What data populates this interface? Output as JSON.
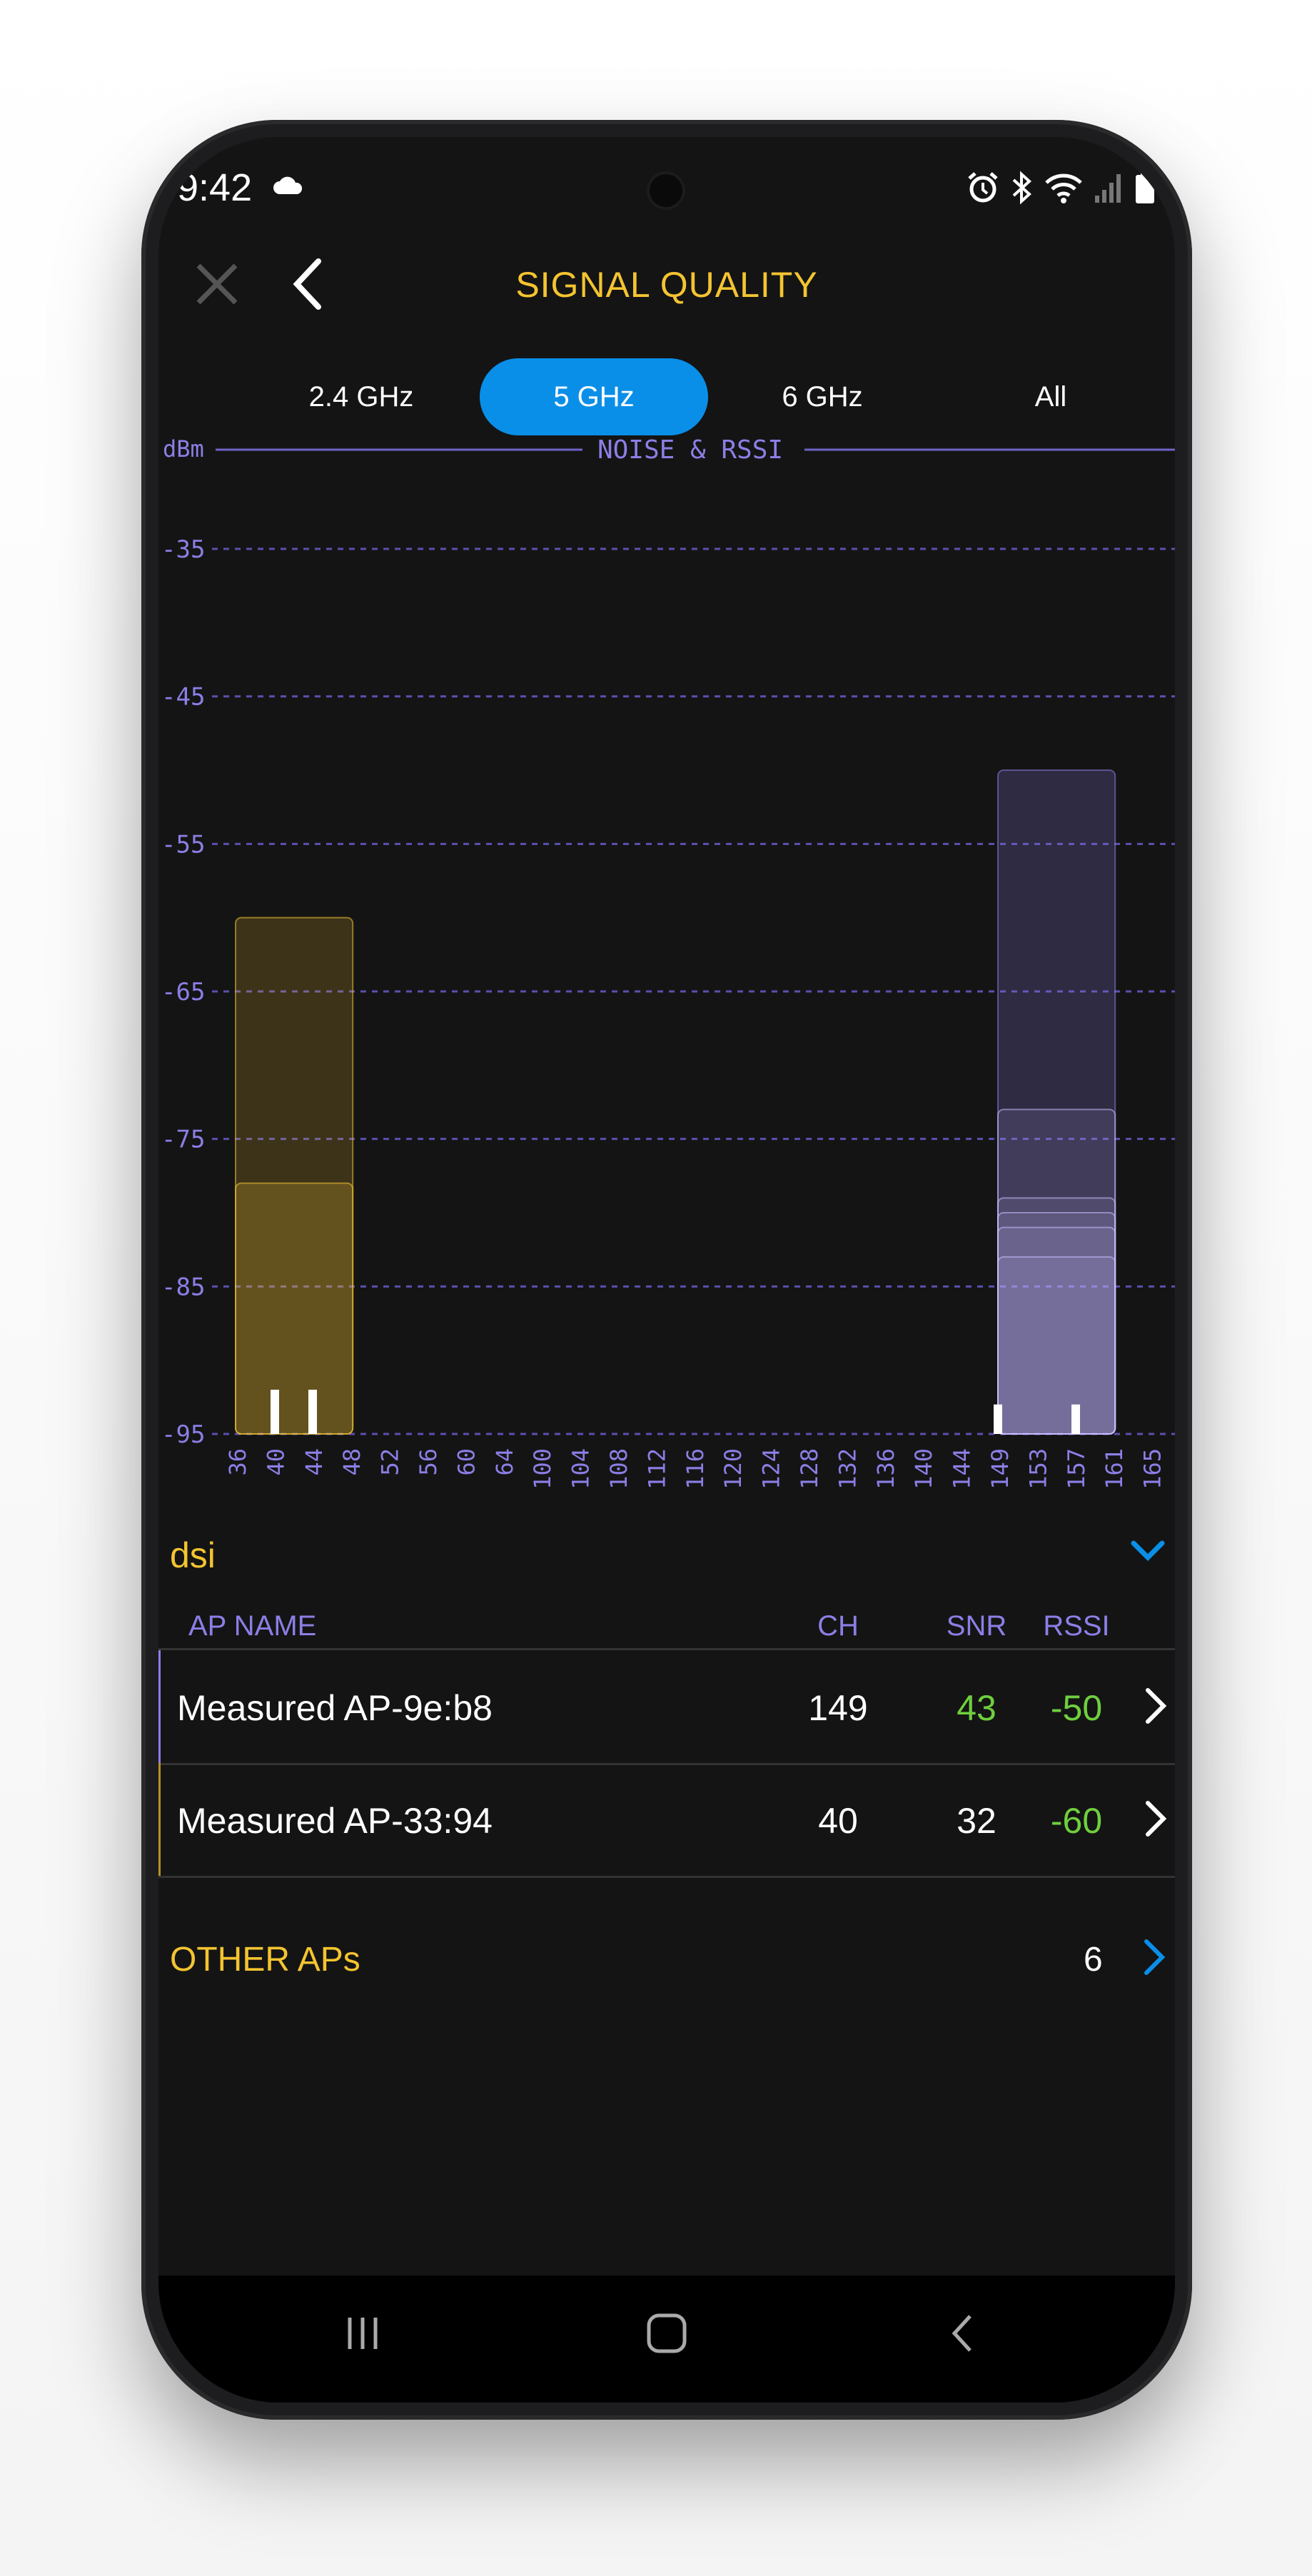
{
  "status_bar": {
    "time": "9:42",
    "icons": [
      "cloud-icon",
      "alarm-icon",
      "bluetooth-icon",
      "wifi-icon",
      "signal-icon",
      "battery-icon"
    ]
  },
  "header": {
    "title": "SIGNAL QUALITY",
    "icons": [
      "close-icon",
      "back-icon"
    ]
  },
  "band_tabs": {
    "items": [
      {
        "label": "2.4 GHz"
      },
      {
        "label": "5 GHz",
        "active": true
      },
      {
        "label": "6 GHz"
      },
      {
        "label": "All"
      }
    ]
  },
  "chart_data": {
    "type": "bar",
    "title": "NOISE & RSSI",
    "ylabel": "dBm",
    "y_ticks": [
      "-35",
      "-45",
      "-55",
      "-65",
      "-75",
      "-85",
      "-95"
    ],
    "ylim": [
      -95,
      -30
    ],
    "categories": [
      "36",
      "40",
      "44",
      "48",
      "52",
      "56",
      "60",
      "64",
      "100",
      "104",
      "108",
      "112",
      "116",
      "120",
      "124",
      "128",
      "132",
      "136",
      "140",
      "144",
      "149",
      "153",
      "157",
      "161",
      "165"
    ],
    "grid": "dashed horizontal",
    "colors": {
      "axis": "#8b7fe6",
      "ap_gold": "#f4c430",
      "ap_purple": "#8b7fe6"
    },
    "series": [
      {
        "name": "Measured AP-33:94",
        "channel_range": [
          "36",
          "48"
        ],
        "rssi": -60,
        "noise": -92,
        "color": "#f4c430"
      },
      {
        "name": "Measured AP-9e:b8",
        "channel_range": [
          "149",
          "161"
        ],
        "rssi": -50,
        "noise": -93,
        "color": "#8b7fe6"
      }
    ],
    "other_bars": [
      {
        "channel_range": [
          "36",
          "48"
        ],
        "rssi": -78
      },
      {
        "channel_range": [
          "149",
          "161"
        ],
        "rssi": -73
      },
      {
        "channel_range": [
          "149",
          "161"
        ],
        "rssi": -79
      },
      {
        "channel_range": [
          "149",
          "161"
        ],
        "rssi": -80
      },
      {
        "channel_range": [
          "149",
          "161"
        ],
        "rssi": -81
      },
      {
        "channel_range": [
          "149",
          "161"
        ],
        "rssi": -83
      }
    ]
  },
  "network": {
    "name": "dsi",
    "columns": {
      "name": "AP NAME",
      "ch": "CH",
      "snr": "SNR",
      "rssi": "RSSI"
    },
    "aps": [
      {
        "name": "Measured AP-9e:b8",
        "ch": "149",
        "snr": "43",
        "rssi": "-50",
        "snr_color": "#6fcf3e",
        "accent": "#8b7fe6"
      },
      {
        "name": "Measured AP-33:94",
        "ch": "40",
        "snr": "32",
        "rssi": "-60",
        "snr_color": "#ffffff",
        "accent": "#b8902a"
      }
    ]
  },
  "other_aps": {
    "label": "OTHER APs",
    "count": "6"
  },
  "nav": {
    "icons": [
      "recent-apps-icon",
      "home-icon",
      "back-nav-icon"
    ]
  }
}
